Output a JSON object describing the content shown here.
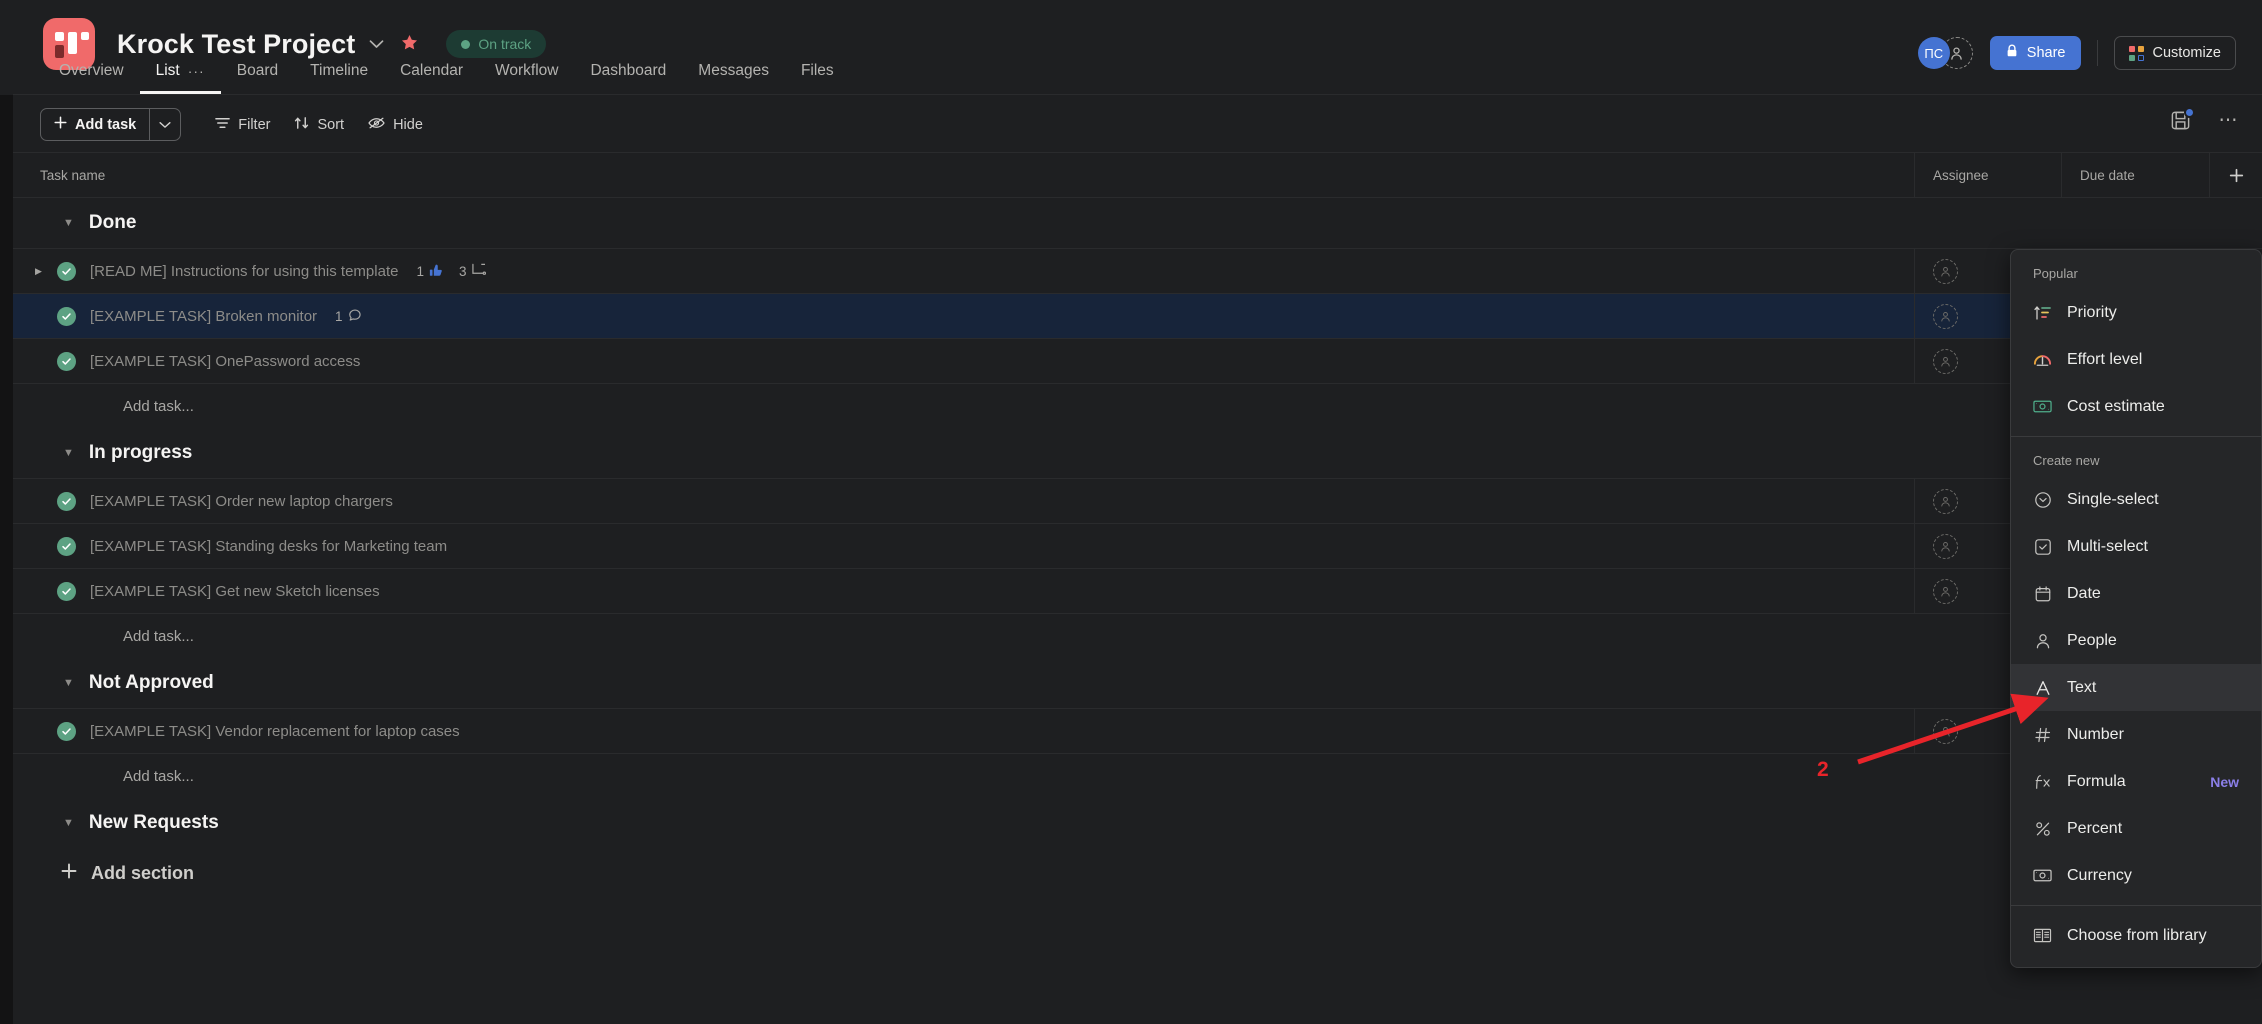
{
  "header": {
    "project_icon": "project-board-icon",
    "title": "Krock Test Project",
    "title_chevron": "chevron-down-icon",
    "star": "star-icon",
    "status": "On track",
    "avatar_initials": "ПС",
    "invite_icon": "person-add-icon",
    "share_label": "Share",
    "share_icon": "lock-icon",
    "customize_label": "Customize",
    "share_color": "#4573d2",
    "status_color": "#5da283",
    "accent_color": "#f06a6a"
  },
  "tabs": [
    {
      "label": "Overview",
      "active": false
    },
    {
      "label": "List",
      "active": true,
      "more": "···"
    },
    {
      "label": "Board",
      "active": false
    },
    {
      "label": "Timeline",
      "active": false
    },
    {
      "label": "Calendar",
      "active": false
    },
    {
      "label": "Workflow",
      "active": false
    },
    {
      "label": "Dashboard",
      "active": false
    },
    {
      "label": "Messages",
      "active": false
    },
    {
      "label": "Files",
      "active": false
    }
  ],
  "toolbar": {
    "add_task_label": "Add task",
    "add_task_icon": "plus-icon",
    "add_task_dropdown_icon": "chevron-down-icon",
    "filter_label": "Filter",
    "filter_icon": "filter-icon",
    "sort_label": "Sort",
    "sort_icon": "sort-arrows-icon",
    "hide_label": "Hide",
    "hide_icon": "eye-slash-icon",
    "save_layout_icon": "save-disk-icon",
    "more_icon": "ellipsis-horizontal-icon"
  },
  "table": {
    "columns": [
      "Task name",
      "Assignee",
      "Due date"
    ],
    "add_column_icon": "plus-icon",
    "add_task_placeholder": "Add task...",
    "add_section_label": "Add section",
    "add_section_icon": "plus-icon",
    "sections": [
      {
        "name": "Done",
        "tasks": [
          {
            "title": "[READ ME] Instructions for using this template",
            "expandable": true,
            "selected": false,
            "meta": [
              {
                "count": "1",
                "icon": "thumbs-up-icon"
              },
              {
                "count": "3",
                "icon": "subtask-icon"
              }
            ]
          },
          {
            "title": "[EXAMPLE TASK] Broken monitor",
            "expandable": false,
            "selected": true,
            "meta": [
              {
                "count": "1",
                "icon": "comment-icon"
              }
            ]
          },
          {
            "title": "[EXAMPLE TASK] OnePassword access",
            "expandable": false,
            "selected": false,
            "meta": []
          }
        ]
      },
      {
        "name": "In progress",
        "tasks": [
          {
            "title": "[EXAMPLE TASK] Order new laptop chargers",
            "expandable": false,
            "selected": false,
            "meta": []
          },
          {
            "title": "[EXAMPLE TASK] Standing desks for Marketing team",
            "expandable": false,
            "selected": false,
            "meta": []
          },
          {
            "title": "[EXAMPLE TASK] Get new Sketch licenses",
            "expandable": false,
            "selected": false,
            "meta": []
          }
        ]
      },
      {
        "name": "Not Approved",
        "tasks": [
          {
            "title": "[EXAMPLE TASK] Vendor replacement for laptop cases",
            "expandable": false,
            "selected": false,
            "meta": []
          }
        ]
      },
      {
        "name": "New Requests",
        "tasks": []
      }
    ]
  },
  "dropdown": {
    "groups": [
      {
        "label": "Popular",
        "items": [
          {
            "label": "Priority",
            "icon": "priority-sort-icon",
            "active": false
          },
          {
            "label": "Effort level",
            "icon": "gauge-icon",
            "active": false
          },
          {
            "label": "Cost estimate",
            "icon": "money-icon",
            "active": false
          }
        ]
      },
      {
        "label": "Create new",
        "items": [
          {
            "label": "Single-select",
            "icon": "single-select-icon",
            "active": false
          },
          {
            "label": "Multi-select",
            "icon": "multi-select-icon",
            "active": false
          },
          {
            "label": "Date",
            "icon": "calendar-icon",
            "active": false
          },
          {
            "label": "People",
            "icon": "person-icon",
            "active": false
          },
          {
            "label": "Text",
            "icon": "text-A-icon",
            "active": true
          },
          {
            "label": "Number",
            "icon": "hash-icon",
            "active": false
          },
          {
            "label": "Formula",
            "icon": "fx-icon",
            "active": false,
            "badge": "New"
          },
          {
            "label": "Percent",
            "icon": "percent-icon",
            "active": false
          },
          {
            "label": "Currency",
            "icon": "currency-icon",
            "active": false
          }
        ]
      },
      {
        "label": "",
        "items": [
          {
            "label": "Choose from library",
            "icon": "library-book-icon",
            "active": false
          }
        ]
      }
    ]
  },
  "annotation": {
    "number": "2",
    "color": "#e8242a",
    "points_to": "Text"
  }
}
